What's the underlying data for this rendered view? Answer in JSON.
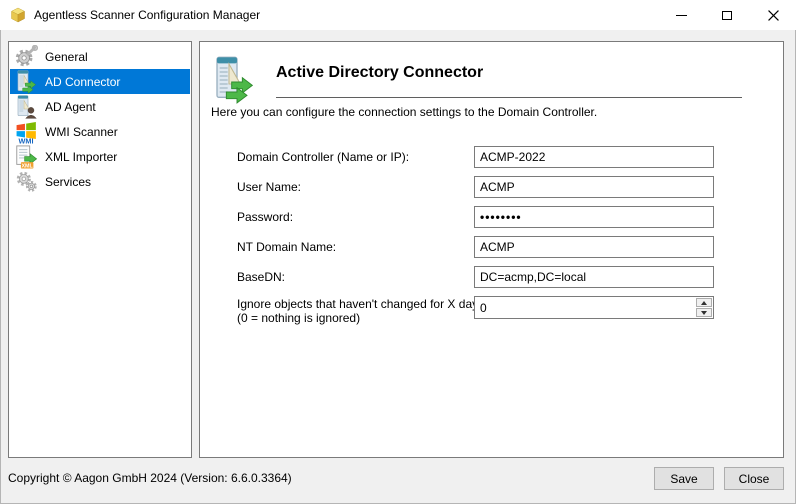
{
  "window": {
    "title": "Agentless Scanner Configuration Manager"
  },
  "colors": {
    "selection_blue": "#0078d7",
    "panel_border": "#7a7a7a",
    "body_background": "#f0f0f0",
    "arrow_green": "#4db848"
  },
  "sidebar": {
    "items": [
      {
        "label": "General",
        "icon": "gear-wrench-icon",
        "selected": false
      },
      {
        "label": "AD Connector",
        "icon": "server-sync-icon",
        "selected": true
      },
      {
        "label": "AD Agent",
        "icon": "server-user-icon",
        "selected": false
      },
      {
        "label": "WMI Scanner",
        "icon": "windows-wmi-icon",
        "selected": false
      },
      {
        "label": "XML Importer",
        "icon": "xml-import-icon",
        "selected": false
      },
      {
        "label": "Services",
        "icon": "gears-icon",
        "selected": false
      }
    ],
    "icon_badges": {
      "wmi": "WMI",
      "xml": "XML"
    }
  },
  "main": {
    "title": "Active Directory Connector",
    "description": "Here you can configure the connection settings to the Domain Controller.",
    "fields": [
      {
        "label": "Domain Controller (Name or IP):",
        "value": "ACMP-2022",
        "type": "text"
      },
      {
        "label": "User Name:",
        "value": "ACMP",
        "type": "text"
      },
      {
        "label": "Password:",
        "value": "••••••••",
        "type": "password"
      },
      {
        "label": "NT Domain Name:",
        "value": "ACMP",
        "type": "text"
      },
      {
        "label": "BaseDN:",
        "value": "DC=acmp,DC=local",
        "type": "text"
      },
      {
        "label": "Ignore objects that haven't changed for X days:",
        "label2": "(0 = nothing is ignored)",
        "value": "0",
        "type": "spinner"
      }
    ]
  },
  "footer": {
    "copyright": "Copyright © Aagon GmbH 2024 (Version: 6.6.0.3364)",
    "save_label": "Save",
    "close_label": "Close"
  }
}
